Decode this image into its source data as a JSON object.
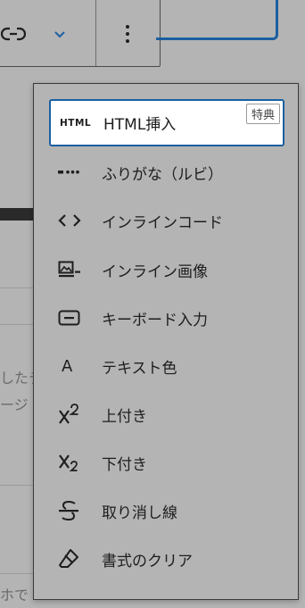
{
  "toolbar": {
    "link_icon": "link-icon",
    "chevron_icon": "chevron-down-icon",
    "more_icon": "more-vertical-icon"
  },
  "background_text": {
    "line1": "したテ",
    "line2": "ージ",
    "line3": "ホで"
  },
  "dropdown": {
    "items": [
      {
        "label": "HTML挿入",
        "icon": "html-icon",
        "icon_text": "HTML",
        "badge": "特典"
      },
      {
        "label": "ふりがな（ルビ）",
        "icon": "ruby-dots-icon"
      },
      {
        "label": "インラインコード",
        "icon": "code-icon"
      },
      {
        "label": "インライン画像",
        "icon": "inline-image-icon"
      },
      {
        "label": "キーボード入力",
        "icon": "keyboard-icon"
      },
      {
        "label": "テキスト色",
        "icon": "text-color-icon",
        "icon_text": "A"
      },
      {
        "label": "上付き",
        "icon": "superscript-icon"
      },
      {
        "label": "下付き",
        "icon": "subscript-icon"
      },
      {
        "label": "取り消し線",
        "icon": "strikethrough-icon"
      },
      {
        "label": "書式のクリア",
        "icon": "eraser-icon"
      }
    ]
  },
  "colors": {
    "accent": "#1b5fa0",
    "backdrop": "#b4b4b4",
    "text": "#1e1e1e"
  }
}
